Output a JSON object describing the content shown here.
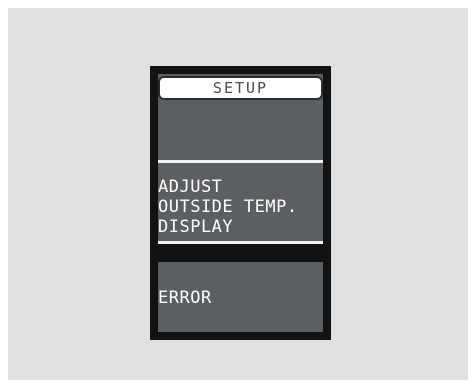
{
  "screen": {
    "title": "SETUP",
    "menu_lines": [
      "ADJUST",
      "OUTSIDE TEMP.",
      "DISPLAY"
    ],
    "error_label": "ERROR"
  },
  "colors": {
    "background": "#dfe0e2",
    "frame": "#111214",
    "screen": "#5c5f62",
    "text": "#ffffff",
    "title_bar": "#ffffff"
  }
}
